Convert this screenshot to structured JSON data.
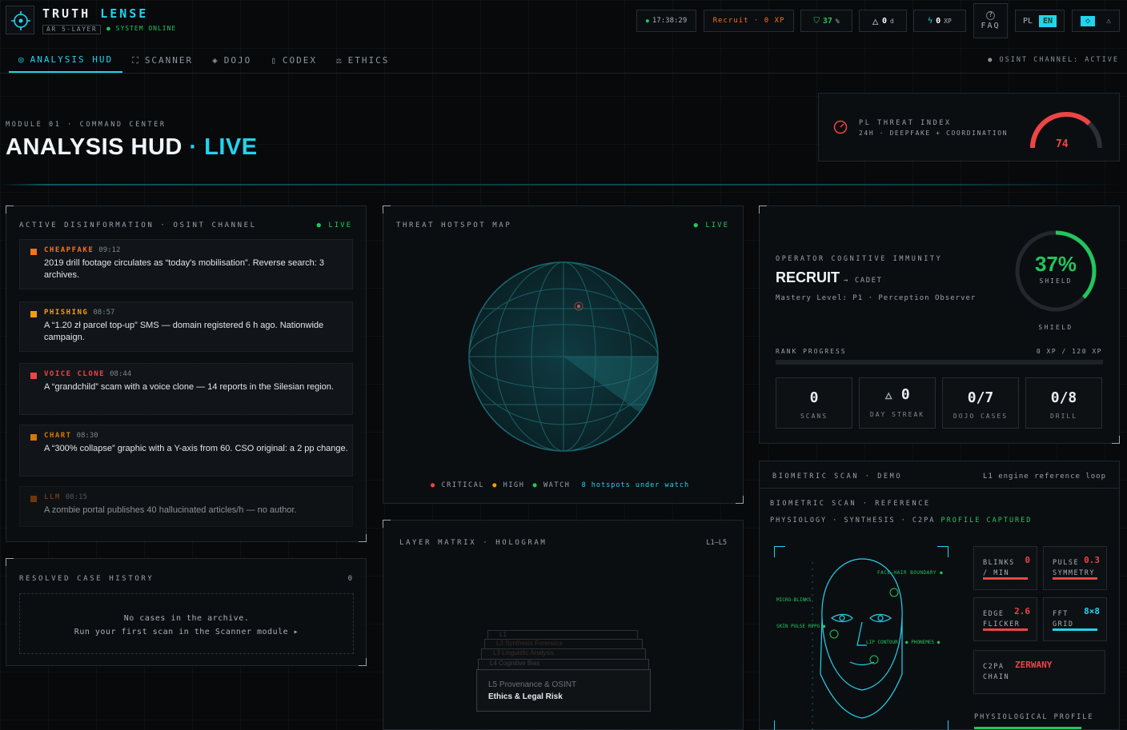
{
  "app": {
    "title": "TRUTH",
    "title_accent": "LENSE",
    "badge": "AR 5-LAYER",
    "status": "● SYSTEM ONLINE"
  },
  "header": {
    "clock": "17:38:29",
    "rank": "Recruit · 0 XP",
    "shield_value": "37",
    "shield_unit": "%",
    "streak_value": "0",
    "streak_unit": "d",
    "xp_value": "0",
    "xp_unit": "XP",
    "faq": "FAQ",
    "lang_pl": "PL",
    "lang_en": "EN"
  },
  "tabs": [
    {
      "label": "ANALYSIS HUD"
    },
    {
      "label": "SCANNER"
    },
    {
      "label": "DOJO"
    },
    {
      "label": "CODEX"
    },
    {
      "label": "ETHICS"
    }
  ],
  "osint_status": "● OSINT CHANNEL: ACTIVE",
  "hero": {
    "kicker": "MODULE 01 · COMMAND CENTER",
    "title": "ANALYSIS HUD",
    "dot": "·",
    "live": "LIVE"
  },
  "threat": {
    "title": "PL THREAT INDEX",
    "sub": "24H · DEEPFAKE + COORDINATION",
    "value": "74",
    "level": 0.74
  },
  "feed": {
    "title": "ACTIVE DISINFORMATION · OSINT CHANNEL",
    "live": "● LIVE",
    "items": [
      {
        "tag": "CHEAPFAKE",
        "time": "09:12",
        "text": "2019 drill footage circulates as “today's mobilisation”. Reverse search: 3 archives.",
        "color": "#f97316"
      },
      {
        "tag": "PHISHING",
        "time": "08:57",
        "text": "A “1.20 zł parcel top-up” SMS — domain registered 6 h ago. Nationwide campaign.",
        "color": "#f59e0b"
      },
      {
        "tag": "VOICE CLONE",
        "time": "08:44",
        "text": "A “grandchild” scam with a voice clone — 14 reports in the Silesian region.",
        "color": "#ef4444"
      },
      {
        "tag": "CHART",
        "time": "08:30",
        "text": "A “300% collapse” graphic with a Y-axis from 60. CSO original: a 2 pp change.",
        "color": "#d97706"
      },
      {
        "tag": "LLM",
        "time": "08:15",
        "text": "A zombie portal publishes 40 hallucinated articles/h — no author.",
        "color": "#b45309"
      }
    ]
  },
  "history": {
    "title": "RESOLVED CASE HISTORY",
    "count": "0",
    "empty1": "No cases in the archive.",
    "empty2": "Run your first scan in the Scanner module ▸"
  },
  "map": {
    "title": "THREAT HOTSPOT MAP",
    "live": "● LIVE",
    "legend": [
      "CRITICAL",
      "HIGH",
      "WATCH"
    ],
    "summary": "8 hotspots under watch"
  },
  "matrix": {
    "title": "LAYER MATRIX · HOLOGRAM",
    "range": "L1–L5",
    "layers": [
      "L1",
      "L2 Synthesis Forensics",
      "L3 Linguistic Analysis",
      "L4 Cognitive Bias",
      "L5 Provenance & OSINT"
    ],
    "front": "Ethics & Legal Risk",
    "front_prefix": "L5"
  },
  "operator": {
    "title": "OPERATOR COGNITIVE IMMUNITY",
    "rank": "RECRUIT",
    "next": "→ CADET",
    "mastery": "Mastery Level: P1 · Perception Observer",
    "shield_pct": "37%",
    "shield_label": "SHIELD",
    "shield_caption": "SHIELD",
    "shield_level": 0.37,
    "progress_label": "RANK PROGRESS",
    "progress_value": "0 XP / 120 XP",
    "progress": 0,
    "stats": [
      {
        "n": "0",
        "l": "SCANS"
      },
      {
        "n": "0",
        "l": "DAY STREAK"
      },
      {
        "n": "0/7",
        "l": "DOJO CASES"
      },
      {
        "n": "0/8",
        "l": "DRILL"
      }
    ]
  },
  "bio": {
    "title": "BIOMETRIC SCAN · DEMO",
    "loop": "L1 engine reference loop",
    "ref": "BIOMETRIC SCAN · REFERENCE",
    "sub": "PHYSIOLOGY · SYNTHESIS · C2PA",
    "captured": "PROFILE CAPTURED",
    "face_labels": [
      "FACE-HAIR BOUNDARY ●",
      "MICRO-BLINKS",
      "SKIN PULSE RPPG ●",
      "LIP CONTOUR",
      "● PHONEMES ●"
    ],
    "metrics": [
      {
        "l1": "BLINKS",
        "l2": "/ MIN",
        "v": "0",
        "c": "#ef4444"
      },
      {
        "l1": "PULSE",
        "l2": "SYMMETRY",
        "v": "0.3",
        "c": "#ef4444"
      },
      {
        "l1": "EDGE",
        "l2": "FLICKER",
        "v": "2.6",
        "c": "#ef4444"
      },
      {
        "l1": "FFT",
        "l2": "GRID",
        "v": "8×8",
        "c": "#22d3ee"
      }
    ],
    "c2pa_l1": "C2PA",
    "c2pa_l2": "CHAIN",
    "c2pa_v": "ZERWANY",
    "profile": "PHYSIOLOGICAL PROFILE"
  }
}
